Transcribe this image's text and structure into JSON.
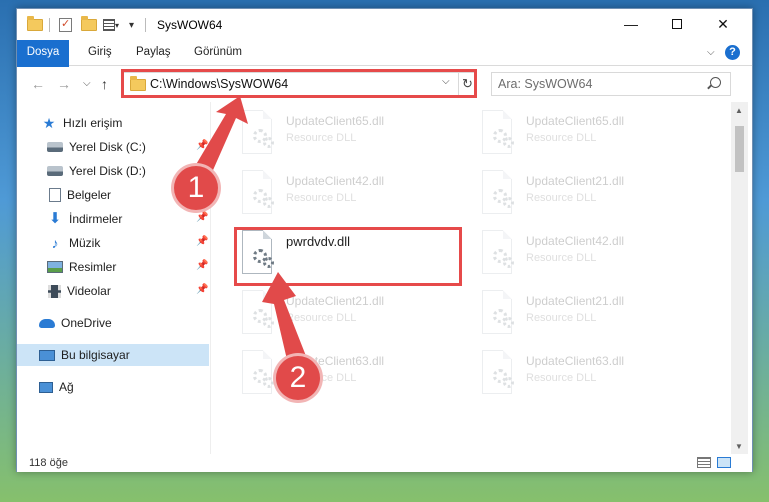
{
  "window": {
    "title": "SysWOW64",
    "controls": {
      "minimize": "—",
      "close": "✕"
    }
  },
  "ribbon": {
    "tabs": [
      "Dosya",
      "Giriş",
      "Paylaş",
      "Görünüm"
    ],
    "help": "?"
  },
  "address": {
    "path": "C:\\Windows\\SysWOW64",
    "dropdown": "⌵",
    "refresh": "↻"
  },
  "search": {
    "placeholder": "Ara: SysWOW64"
  },
  "nav_buttons": {
    "back": "←",
    "forward": "→",
    "recent": "⌵",
    "up": "↑"
  },
  "sidebar": {
    "items": [
      {
        "label": "Hızlı erişim",
        "icon": "star-icon"
      },
      {
        "label": "Yerel Disk (C:)",
        "icon": "drive-icon"
      },
      {
        "label": "Yerel Disk (D:)",
        "icon": "drive-icon"
      },
      {
        "label": "Belgeler",
        "icon": "documents-icon"
      },
      {
        "label": "İndirmeler",
        "icon": "download-icon"
      },
      {
        "label": "Müzik",
        "icon": "music-icon"
      },
      {
        "label": "Resimler",
        "icon": "pictures-icon"
      },
      {
        "label": "Videolar",
        "icon": "video-icon"
      },
      {
        "label": "OneDrive",
        "icon": "cloud-icon"
      },
      {
        "label": "Bu bilgisayar",
        "icon": "computer-icon",
        "selected": true
      },
      {
        "label": "Ağ",
        "icon": "network-icon"
      }
    ]
  },
  "files": [
    {
      "name": "UpdateClient65.dll",
      "desc": "Resource DLL"
    },
    {
      "name": "UpdateClient65.dll",
      "desc": "Resource DLL"
    },
    {
      "name": "UpdateClient42.dll",
      "desc": "Resource DLL"
    },
    {
      "name": "UpdateClient21.dll",
      "desc": "Resource DLL"
    },
    {
      "name": "pwrdvdv.dll",
      "desc": ""
    },
    {
      "name": "UpdateClient42.dll",
      "desc": "Resource DLL"
    },
    {
      "name": "UpdateClient21.dll",
      "desc": "Resource DLL"
    },
    {
      "name": "UpdateClient21.dll",
      "desc": "Resource DLL"
    },
    {
      "name": "UpdateClient63.dll",
      "desc": "Resource DLL"
    },
    {
      "name": "UpdateClient63.dll",
      "desc": "Resource DLL"
    }
  ],
  "status": {
    "count": "118 öğe"
  },
  "annotations": {
    "step1": "1",
    "step2": "2",
    "color": "#e14a4a"
  }
}
